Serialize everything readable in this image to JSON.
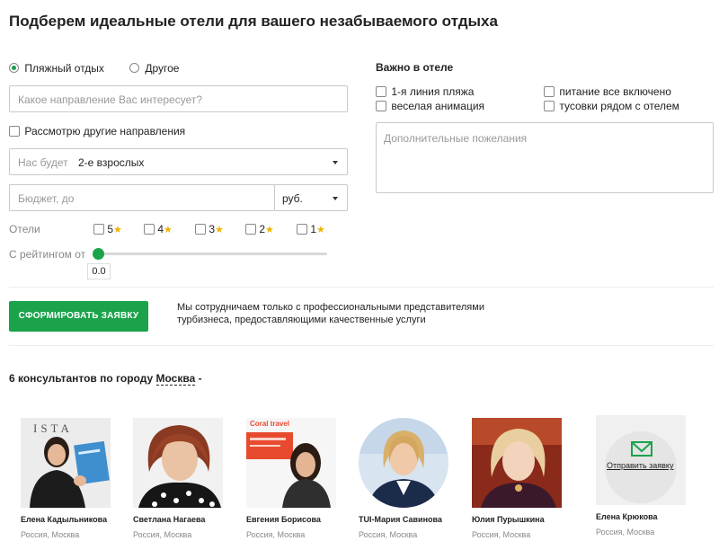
{
  "title": "Подберем идеальные отели для вашего незабываемого отдыха",
  "trip_type": {
    "beach_label": "Пляжный отдых",
    "other_label": "Другое"
  },
  "destination": {
    "placeholder": "Какое направление Вас интересует?"
  },
  "consider_other_label": "Рассмотрю другие направления",
  "guests": {
    "label": "Нас будет",
    "value": "2-е взрослых"
  },
  "budget": {
    "placeholder": "Бюджет, до",
    "currency": "руб."
  },
  "hotels": {
    "label": "Отели",
    "stars": [
      "5",
      "4",
      "3",
      "2",
      "1"
    ]
  },
  "rating": {
    "label": "С рейтингом от",
    "value": "0.0",
    "level": 0
  },
  "important": {
    "title": "Важно в отеле",
    "options": [
      "1-я линия пляжа",
      "питание все включено",
      "веселая анимация",
      "тусовки рядом с отелем"
    ]
  },
  "wishes": {
    "placeholder": "Дополнительные пожелания"
  },
  "submit_label": "СФОРМИРОВАТЬ ЗАЯВКУ",
  "cooperation_text_1": "Мы сотрудничаем только с профессиональными представителями",
  "cooperation_text_2": "турбизнеса, предоставляющими качественные услуги",
  "consultants_heading": {
    "prefix": "6 консультантов по городу",
    "city": "Москва",
    "suffix": "-"
  },
  "consultants": [
    {
      "name": "Елена Кадыльникова",
      "city": "Россия, Москва",
      "photo_text": "ISTA"
    },
    {
      "name": "Светлана Нагаева",
      "city": "Россия, Москва"
    },
    {
      "name": "Евгения Борисова",
      "city": "Россия, Москва",
      "photo_text": "Coral travel"
    },
    {
      "name": "TUI-Мария Савинова",
      "city": "Россия, Москва"
    },
    {
      "name": "Юлия Пурышкина",
      "city": "Россия, Москва"
    },
    {
      "name": "Елена Крюкова",
      "city": "Россия, Москва",
      "overlay": "Отправить заявку"
    }
  ],
  "colors": {
    "accent": "#1aa34a",
    "star": "#f0b400"
  }
}
